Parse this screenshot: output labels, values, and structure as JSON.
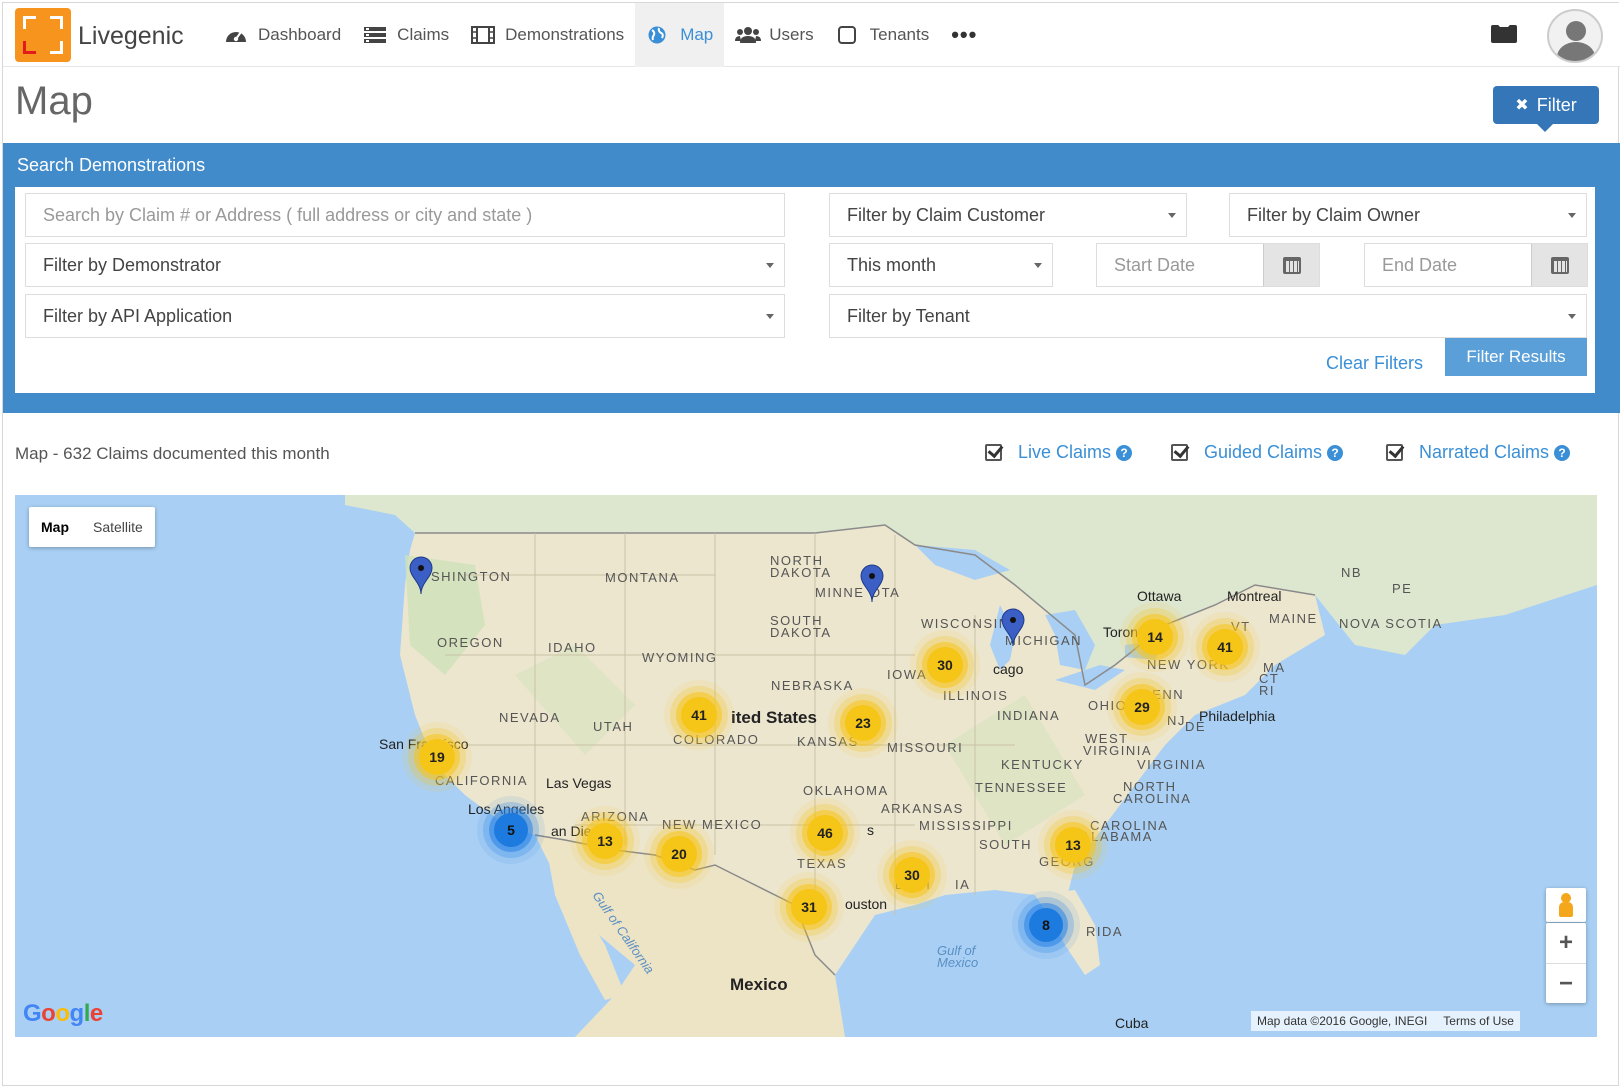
{
  "app": {
    "name": "Livegenic"
  },
  "nav": {
    "items": [
      {
        "label": "Dashboard",
        "icon": "dashboard-icon"
      },
      {
        "label": "Claims",
        "icon": "claims-icon"
      },
      {
        "label": "Demonstrations",
        "icon": "film-icon"
      },
      {
        "label": "Map",
        "icon": "globe-icon",
        "active": true
      },
      {
        "label": "Users",
        "icon": "users-icon"
      },
      {
        "label": "Tenants",
        "icon": "square-icon"
      }
    ],
    "more": "•••"
  },
  "header": {
    "title": "Map",
    "filter_button": "Filter"
  },
  "search": {
    "title": "Search Demonstrations",
    "address_placeholder": "Search by Claim # or Address ( full address or city and state )",
    "claim_customer": "Filter by Claim Customer",
    "claim_owner": "Filter by Claim Owner",
    "demonstrator": "Filter by Demonstrator",
    "period": "This month",
    "start_date": "Start Date",
    "end_date": "End Date",
    "api_application": "Filter by API Application",
    "tenant": "Filter by Tenant",
    "clear": "Clear Filters",
    "submit": "Filter Results"
  },
  "map_header": {
    "summary": "Map - 632 Claims documented this month",
    "legend": [
      "Live Claims",
      "Guided Claims",
      "Narrated Claims"
    ],
    "help_glyph": "?"
  },
  "map": {
    "types": [
      "Map",
      "Satellite"
    ],
    "states": [
      "SHINGTON",
      "MONTANA",
      "NORTH",
      "DAKOTA",
      "MINNE",
      "OTA",
      "SOUTH",
      "DAKOTA",
      "OREGON",
      "IDAHO",
      "WYOMING",
      "WISCONSIN",
      "MICHIGAN",
      "NEBRASKA",
      "IOWA",
      "ILLINOIS",
      "NEVADA",
      "UTAH",
      "COLORADO",
      "KANSAS",
      "MISSOURI",
      "INDIANA",
      "OHIO",
      "WEST",
      "VIRGINIA",
      "KENTUCKY",
      "VIRGINIA",
      "CALIFORNIA",
      "OKLAHOMA",
      "TENNESSEE",
      "NORTH",
      "CAROLINA",
      "ARIZONA",
      "NEW MEXICO",
      "ARKANSAS",
      "MISSISSIPPI",
      "SOUTH",
      "CAROLINA",
      "ALABAMA",
      "GEORG",
      "TEXAS",
      "LOUI",
      "IA",
      "RIDA",
      "NEW YORK",
      "PENN",
      "MAINE",
      "NOVA SCOTIA",
      "NB",
      "PE",
      "VT",
      "MA",
      "CT",
      "RI",
      "NJ",
      "DE"
    ],
    "cities": [
      "Ottawa",
      "Montreal",
      "Toronto",
      "cago",
      "Philadelphia",
      "San Francisco",
      "Las Vegas",
      "Los Angeles",
      "an Diego",
      "D",
      "s",
      "ouston"
    ],
    "country": "ited States",
    "mexico": "Mexico",
    "gulf_california": "Gulf of California",
    "gulf_mexico": [
      "Gulf of",
      "Mexico"
    ],
    "cuba": "Cuba",
    "clusters": [
      {
        "count": "19",
        "color": "yellow"
      },
      {
        "count": "41",
        "color": "yellow"
      },
      {
        "count": "23",
        "color": "yellow"
      },
      {
        "count": "30",
        "color": "yellow"
      },
      {
        "count": "14",
        "color": "yellow"
      },
      {
        "count": "41",
        "color": "yellow"
      },
      {
        "count": "29",
        "color": "yellow"
      },
      {
        "count": "5",
        "color": "blue"
      },
      {
        "count": "13",
        "color": "yellow"
      },
      {
        "count": "20",
        "color": "yellow"
      },
      {
        "count": "46",
        "color": "yellow"
      },
      {
        "count": "30",
        "color": "yellow"
      },
      {
        "count": "31",
        "color": "yellow"
      },
      {
        "count": "13",
        "color": "yellow"
      },
      {
        "count": "8",
        "color": "blue"
      }
    ],
    "zoom_in": "+",
    "zoom_out": "−",
    "google": "Google",
    "attribution": "Map data ©2016 Google, INEGI",
    "terms": "Terms of Use"
  },
  "colors": {
    "primary": "#428bca",
    "button": "#3476b7",
    "link": "#3a8fd6",
    "brand": "#f7941d",
    "cluster_yellow": "#f5c518",
    "cluster_blue": "#1d7be0"
  }
}
